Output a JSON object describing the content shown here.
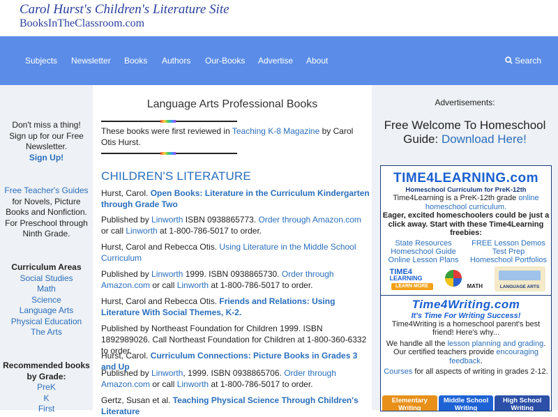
{
  "site": {
    "title": "Carol Hurst's Children's Literature Site",
    "domain": "BooksInTheClassroom.com"
  },
  "nav": {
    "items": [
      "Subjects",
      "Newsletter",
      "Books",
      "Authors",
      "Our-Books",
      "Advertise",
      "About"
    ],
    "search_label": "Search"
  },
  "left": {
    "newsletter_text": "Don't miss a thing! Sign up for our Free Newsletter.",
    "signup_label": "Sign Up!",
    "guides_link": "Free Teacher's Guides",
    "guides_text": "for Novels, Picture Books and Nonfiction. For Preschool through Ninth Grade.",
    "curriculum_heading": "Curriculum Areas",
    "curriculum_items": [
      "Social Studies",
      "Math",
      "Science",
      "Language Arts",
      "Physical Education",
      "The Arts"
    ],
    "recommended_heading": "Recommended books by Grade:",
    "grade_items": [
      "PreK",
      "K",
      "First"
    ]
  },
  "main": {
    "title": "Language Arts Professional Books",
    "intro_before": "These books were first reviewed in ",
    "intro_link": "Teaching K-8 Magazine",
    "intro_after": " by Carol Otis Hurst.",
    "section_heading": "CHILDREN'S LITERATURE",
    "entries": [
      {
        "author": "Hurst, Carol. ",
        "title": "Open Books: Literature in the Curriculum Kindergarten through Grade Two",
        "bold": true
      },
      {
        "pub1": "Published by ",
        "publisher": "Linworth",
        "pub2": " ISBN 0938865773. ",
        "order": "Order through Amazon.com",
        "pub3": " or call ",
        "publisher2": "Linworth",
        "pub4": " at 1-800-786-5017 to order."
      },
      {
        "author": "Hurst, Carol and Rebecca Otis. ",
        "title": "Using Literature in the Middle School Curriculum",
        "bold": false
      },
      {
        "pub1": "Published by ",
        "publisher": "Linworth",
        "pub2": " 1999. ISBN 0938865730. ",
        "order": "Order through Amazon.com",
        "pub3": " or call ",
        "publisher2": "Linworth",
        "pub4": " at 1-800-786-5017 to order."
      },
      {
        "author": "Hurst, Carol and Rebecca Otis. ",
        "title": "Friends and Relations: Using Literature With Social Themes, K-2.",
        "bold": true
      },
      {
        "plain": "Published by Northeast Foundation for Children 1999. ISBN 1892989026. Call Northeast Foundation for Children at 1-800-360-6332 to order."
      },
      {
        "author": "Hurst, Carol. ",
        "title": "Curriculum Connections: Picture Books in Grades 3 and Up",
        "bold": true
      },
      {
        "pub1": "Published by ",
        "publisher": "Linworth",
        "pub2": ", 1999. ISBN 0938865706. ",
        "order": "Order through Amazon.com",
        "pub3": " or call ",
        "publisher2": "Linworth",
        "pub4": " at 1-800-786-5017 to order."
      },
      {
        "author": "Gertz, Susan et al. ",
        "title": "Teaching Physical Science Through Children's Literature",
        "bold": true
      }
    ]
  },
  "right": {
    "ad_label": "Advertisements:",
    "welcome_text": "Free Welcome To Homeschool Guide: ",
    "welcome_link": "Download Here!",
    "t4l": {
      "logo": "TIME4LEARNING.com",
      "subtitle": "Homeschool Curriculum for PreK-12th",
      "text_before": "Time4Learning is a PreK-12th grade ",
      "text_link": "online homeschool curriculum.",
      "bold_text": "Eager, excited homeschoolers could be just a click away. Start with these Time4Learning freebies:",
      "links": [
        "State Resources",
        "FREE Lesson Demos",
        "Homeschool Guide",
        "Test Prep",
        "Online Lesson Plans",
        "Homeschool Portfolios"
      ],
      "promo_labels": [
        "LEARN MORE",
        "MATH",
        "LANGUAGE ARTS"
      ]
    },
    "t4w": {
      "logo": "Time4Writing.com",
      "tagline": "It's Time For Writing Success!",
      "text1": "Time4Writing is a homeschool parent's best friend! Here's why...",
      "text2_before": "We handle all the ",
      "text2_link": "lesson planning and grading",
      "text2_mid": ". Our certified teachers provide ",
      "text2_link2": "encouraging feedback",
      "text2_after": ".",
      "text3_link": "Courses",
      "text3_after": " for all aspects of writing in grades 2-12.",
      "buttons": [
        "Elementary Writing",
        "Middle School Writing",
        "High School Writing"
      ],
      "button_colors": [
        "#e8901a",
        "#1e63d6",
        "#2c50a8"
      ]
    }
  }
}
